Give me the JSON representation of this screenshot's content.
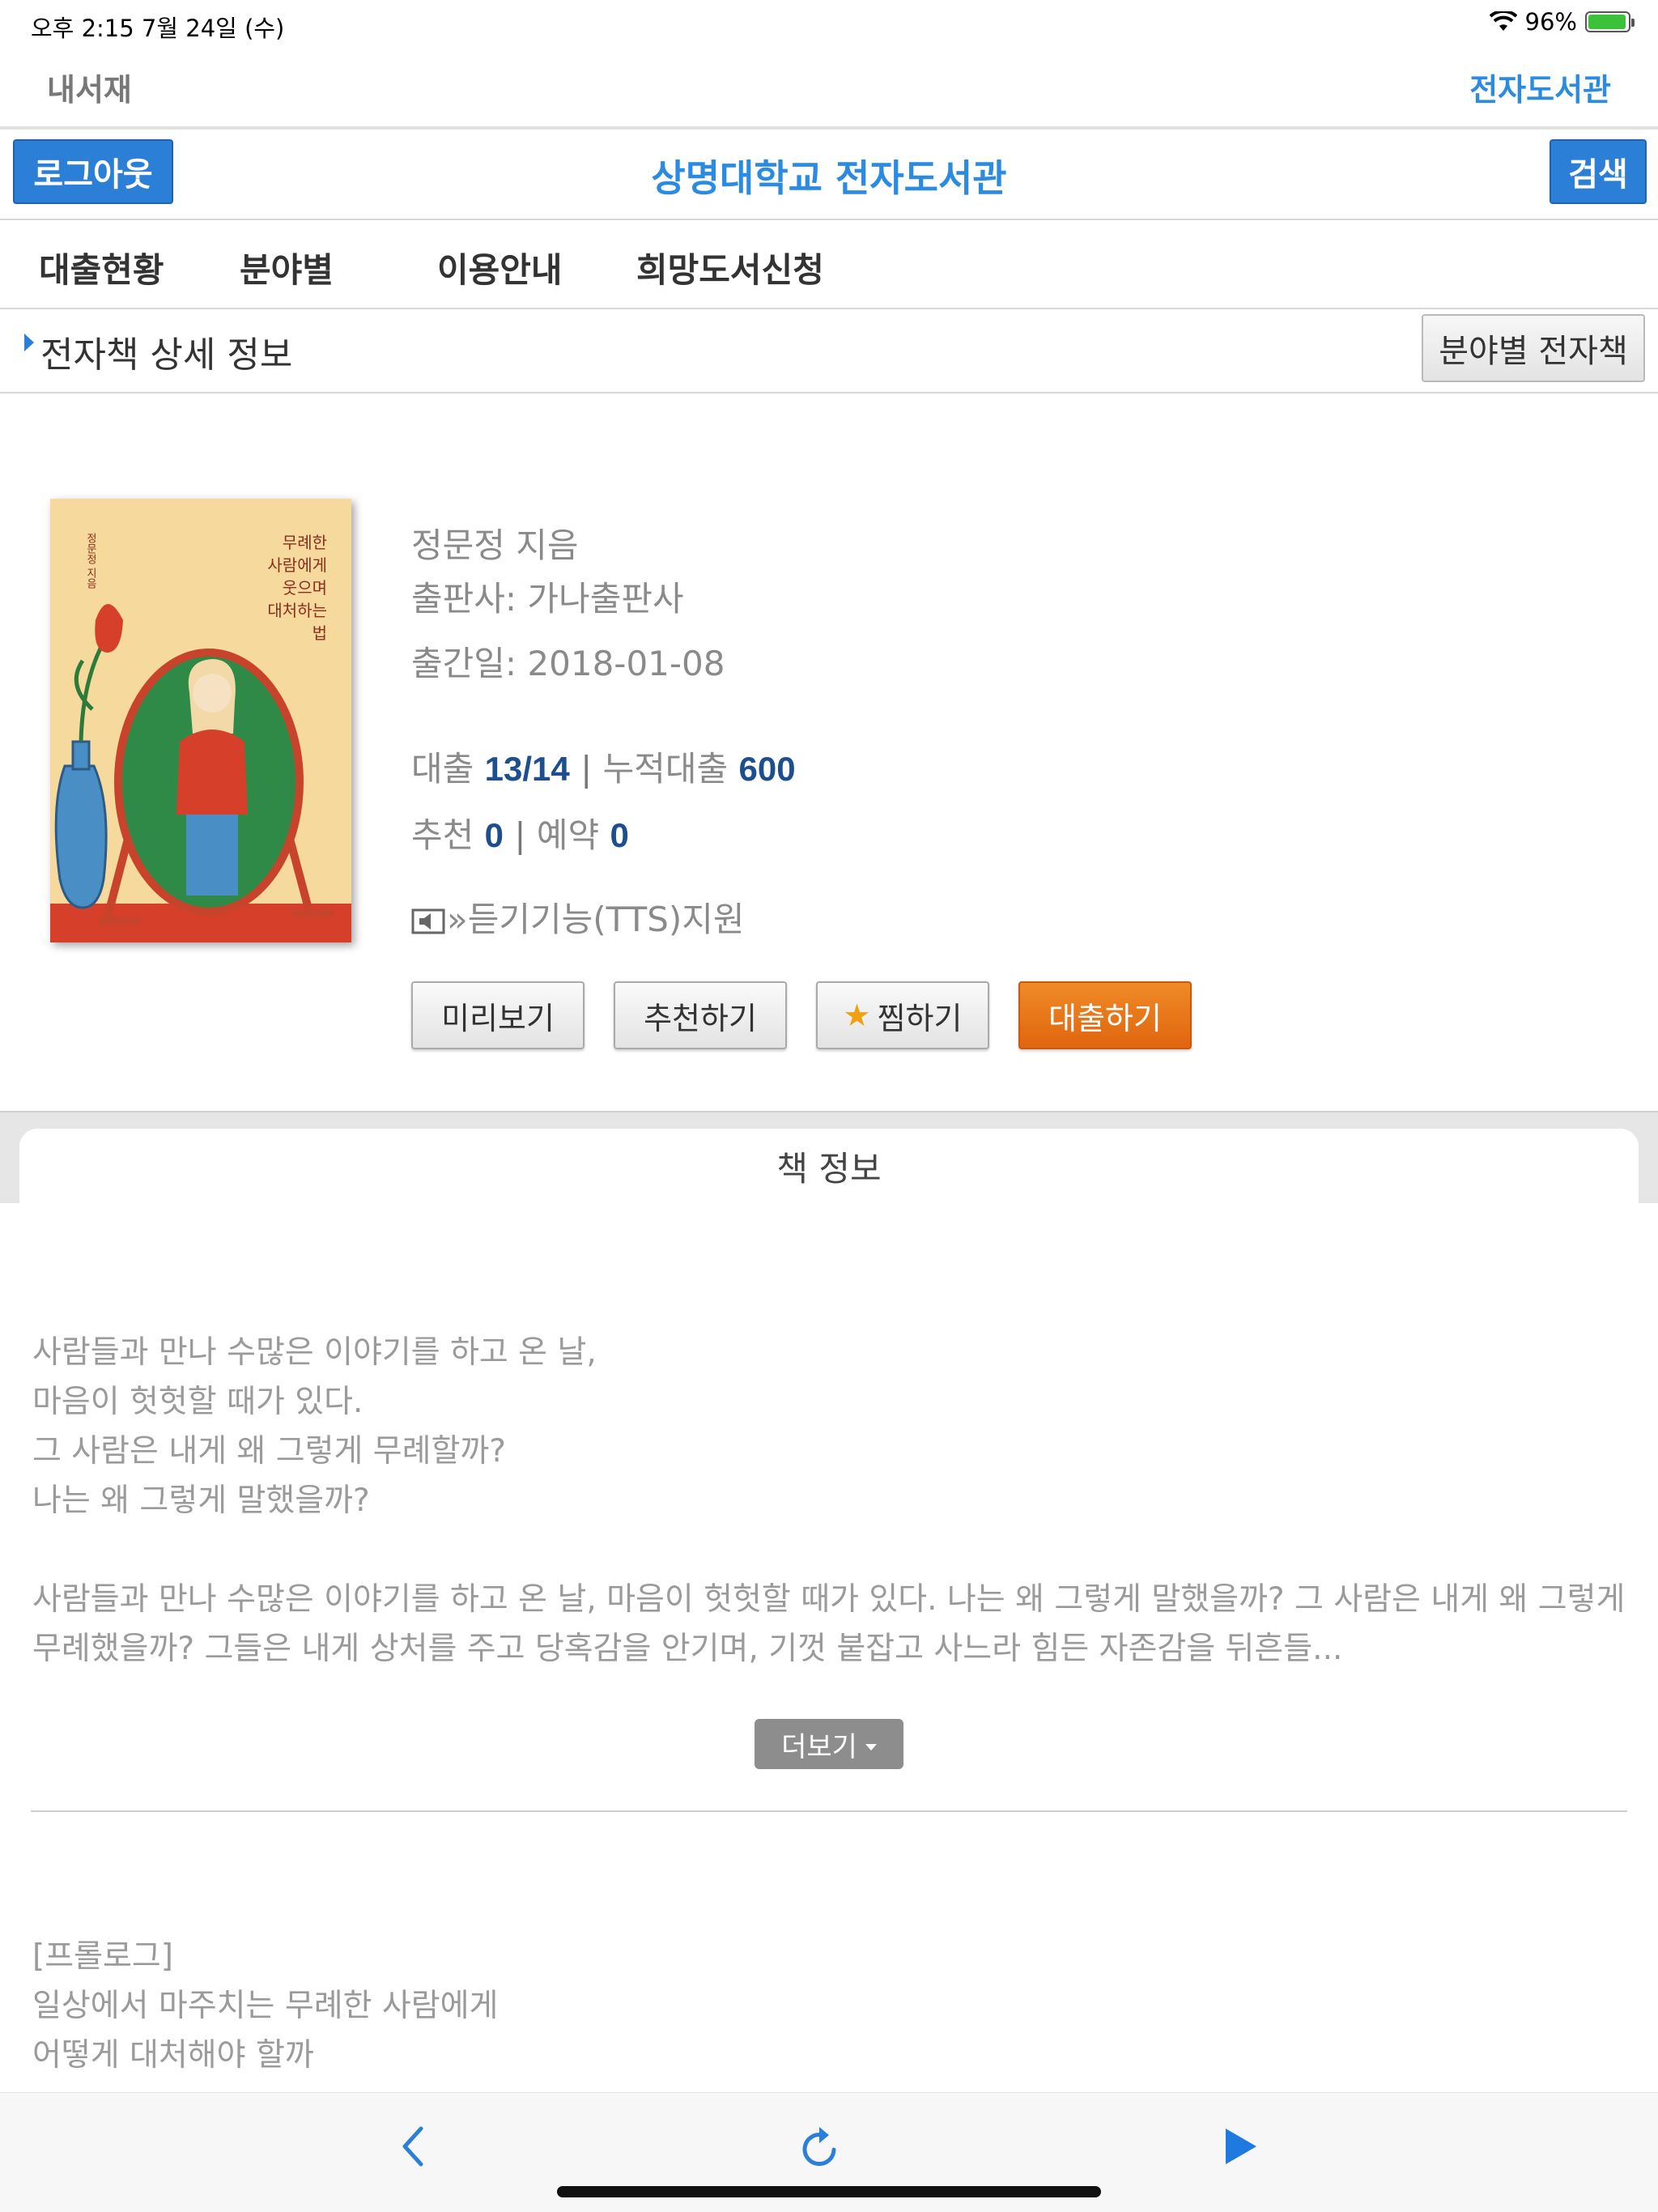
{
  "status_bar": {
    "time": "오후 2:15   7월 24일 (수)",
    "battery": "96%",
    "battery_level": 0.96
  },
  "navbar": {
    "back_label": "내서재",
    "ebook_label": "전자도서관"
  },
  "header": {
    "logout_label": "로그아웃",
    "title": "상명대학교 전자도서관",
    "search_label": "검색"
  },
  "menu": {
    "items": [
      {
        "label": "대출현황"
      },
      {
        "label": "분야별"
      },
      {
        "label": "이용안내"
      },
      {
        "label": "희망도서신청"
      }
    ]
  },
  "section": {
    "title": "전자책 상세 정보",
    "category_button": "분야별 전자책"
  },
  "book": {
    "cover_title_lines": [
      "무례한",
      "사람에게",
      "웃으며",
      "대처하는",
      "법"
    ],
    "author": "정문정 지음",
    "publisher": "출판사: 가나출판사",
    "pub_date": "출간일: 2018-01-08",
    "loan_label": "대출",
    "loan_value": "13/14",
    "cumulative_label": "누적대출",
    "cumulative_value": "600",
    "recommend_label": "추천",
    "recommend_value": "0",
    "reserve_label": "예약",
    "reserve_value": "0",
    "separator": "|",
    "tts_label": "»듣기기능(TTS)지원"
  },
  "actions": {
    "preview": "미리보기",
    "recommend": "추천하기",
    "wish": "찜하기",
    "loan": "대출하기"
  },
  "tab": {
    "title": "책 정보"
  },
  "description": {
    "lines": [
      "사람들과 만나 수많은 이야기를 하고 온 날,",
      "마음이 헛헛할 때가 있다.",
      "그 사람은 내게 왜 그렇게 무례할까?",
      "나는 왜 그렇게 말했을까?"
    ],
    "summary_line1": "사람들과 만나 수많은 이야기를 하고 온 날, 마음이 헛헛할 때가 있다. 나는 왜 그렇게 말했을까? 그 사람은 내게 왜 그렇게",
    "summary_line2": "무례했을까? 그들은 내게 상처를 주고 당혹감을 안기며, 기껏 붙잡고 사느라 힘든 자존감을 뒤흔들...",
    "more_label": "더보기"
  },
  "prologue": {
    "lines": [
      "[프롤로그]",
      "일상에서 마주치는 무례한 사람에게",
      "어떻게 대처해야 할까"
    ]
  },
  "toolbar": {
    "back_icon": "chevron-left-icon",
    "refresh_icon": "refresh-icon",
    "forward_icon": "play-forward-icon"
  },
  "colors": {
    "accent_blue": "#2c7fd6",
    "link_blue": "#2a8be0",
    "loan_orange": "#e97a1a",
    "number_blue": "#1d4f8f"
  }
}
